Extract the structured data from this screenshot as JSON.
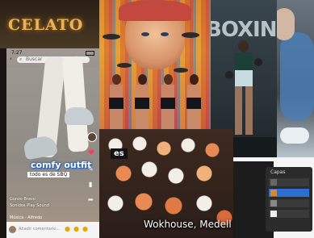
{
  "sneaker_post": {
    "store_sign": "CELATO",
    "status_time": "7:27",
    "search_placeholder": "Buscar",
    "caption_line1": "comfy outfit",
    "caption_line2": "todo es de SBQ",
    "username": "Gonzo Bravo",
    "audio_label": "Sonidos Play Sound",
    "comment_placeholder": "Añadir comentario...",
    "music_label": "Música - Alfredo"
  },
  "food_post": {
    "sticker_text": "es",
    "location_caption": "Wokhouse, Medell"
  },
  "drawing_post": {
    "panel_title": "Capas"
  },
  "gym_post": {
    "wall_text": "BOXING"
  }
}
